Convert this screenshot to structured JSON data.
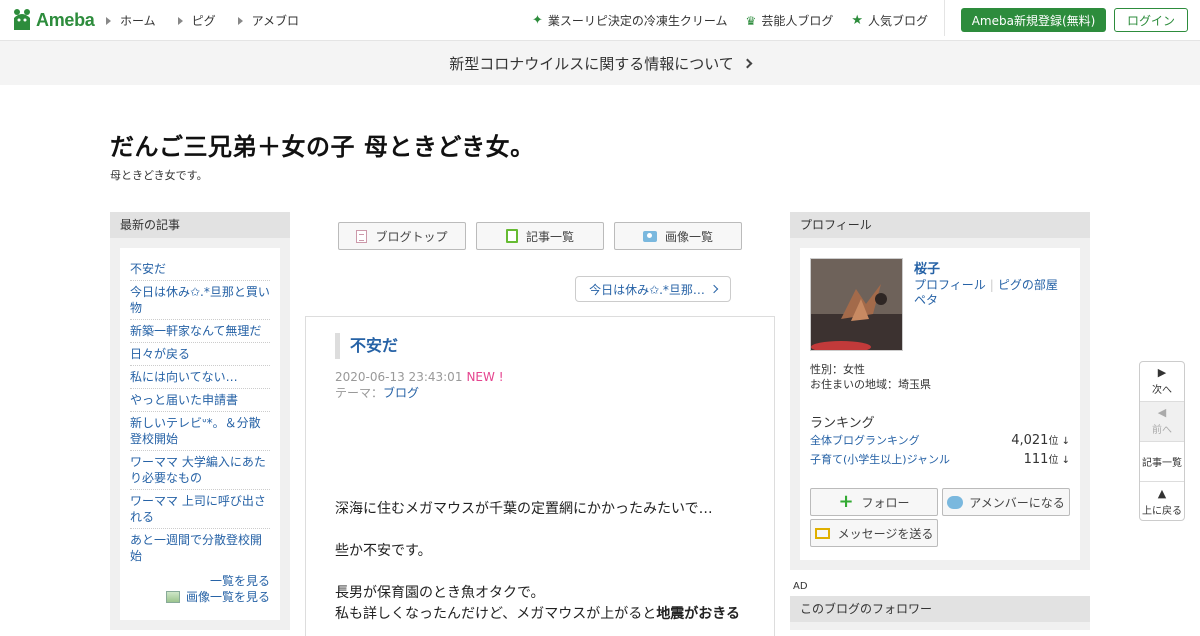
{
  "header": {
    "logo_text": "Ameba",
    "nav": [
      "ホーム",
      "ピグ",
      "アメブロ"
    ],
    "right_links": [
      {
        "label": "業スーリピ決定の冷凍生クリーム",
        "icon": "star-icon"
      },
      {
        "label": "芸能人ブログ",
        "icon": "crown-icon"
      },
      {
        "label": "人気ブログ",
        "icon": "star-icon"
      }
    ],
    "register_label": "Ameba新規登録(無料)",
    "login_label": "ログイン"
  },
  "notice": {
    "text": "新型コロナウイルスに関する情報について"
  },
  "blog": {
    "title": "だんご三兄弟＋女の子 母ときどき女。",
    "description": "母ときどき女です。"
  },
  "left": {
    "heading": "最新の記事",
    "articles": [
      "不安だ",
      "今日は休み✩.*旦那と買い物",
      "新築一軒家なんて無理だ",
      "日々が戻る",
      "私には向いてない…",
      "やっと届いた申請書",
      "新しいテレビᐡ*。＆分散登校開始",
      "ワーママ 大学編入にあたり必要なもの",
      "ワーママ 上司に呼び出される",
      "あと一週間で分散登校開始"
    ],
    "more_label": "一覧を見る",
    "images_label": "画像一覧を見る"
  },
  "center": {
    "buttons": [
      "ブログトップ",
      "記事一覧",
      "画像一覧"
    ],
    "next_entry": "今日は休み✩.*旦那…",
    "entry": {
      "title": "不安だ",
      "datetime": "2020-06-13 23:43:01",
      "new_badge": "NEW !",
      "theme_label": "テーマ：",
      "theme": "ブログ",
      "body": [
        "深海に住むメガマウスが千葉の定置網にかかったみたいで…",
        "些か不安です。",
        "長男が保育園のとき魚オタクで。",
        "私も詳しくなったんだけど、メガマウスが上がると",
        "地震がおきる"
      ]
    }
  },
  "right": {
    "heading": "プロフィール",
    "name": "桜子",
    "links": [
      "プロフィール",
      "ピグの部屋",
      "ペタ"
    ],
    "gender": "性別：女性",
    "location": "お住まいの地域：埼玉県",
    "ranking_heading": "ランキング",
    "rankings": [
      {
        "label": "全体ブログランキング",
        "value": "4,021",
        "unit": "位 ↓"
      },
      {
        "label": "子育て(小学生以上)ジャンル",
        "value": "111",
        "unit": "位 ↓"
      }
    ],
    "follow_label": "フォロー",
    "amember_label": "アメンバーになる",
    "message_label": "メッセージを送る",
    "ad_label": "AD",
    "followers_heading": "このブログのフォロワー"
  },
  "floating_nav": [
    {
      "glyph": "▶",
      "label": "次へ",
      "disabled": false
    },
    {
      "glyph": "◀",
      "label": "前へ",
      "disabled": true
    },
    {
      "glyph": "",
      "label": "記事一覧",
      "disabled": false
    },
    {
      "glyph": "▲",
      "label": "上に戻る",
      "disabled": false
    }
  ],
  "colors": {
    "brand_green": "#2d8c3c",
    "link_blue": "#2662a6",
    "new_pink": "#e5448f"
  }
}
